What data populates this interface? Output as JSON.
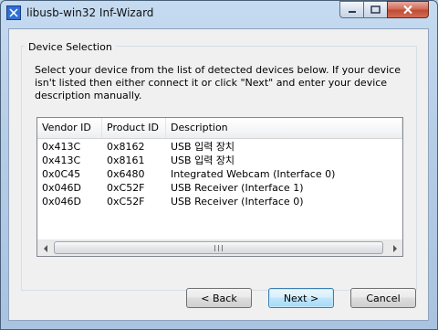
{
  "window": {
    "title": "libusb-win32 Inf-Wizard"
  },
  "groupbox": {
    "label": "Device Selection"
  },
  "instructions": "Select your device from the list of detected devices below. If your device isn't listed then either connect it or click \"Next\" and enter your device description manually.",
  "device_list": {
    "columns": [
      "Vendor ID",
      "Product ID",
      "Description"
    ],
    "rows": [
      [
        "0x413C",
        "0x8162",
        "USB 입력 장치"
      ],
      [
        "0x413C",
        "0x8161",
        "USB 입력 장치"
      ],
      [
        "0x0C45",
        "0x6480",
        "Integrated Webcam (Interface 0)"
      ],
      [
        "0x046D",
        "0xC52F",
        "USB Receiver (Interface 1)"
      ],
      [
        "0x046D",
        "0xC52F",
        "USB Receiver (Interface 0)"
      ]
    ]
  },
  "buttons": {
    "back": "< Back",
    "next": "Next >",
    "cancel": "Cancel"
  },
  "icons": {
    "window": "libusb-app-icon",
    "minimize": "minimize-icon",
    "maximize": "maximize-icon",
    "close": "close-icon",
    "scroll_left": "arrow-left-icon",
    "scroll_right": "arrow-right-icon"
  },
  "colors": {
    "title_bar": "#b6cde6",
    "close_button": "#c24a33",
    "default_button_border": "#3c7fb1"
  }
}
